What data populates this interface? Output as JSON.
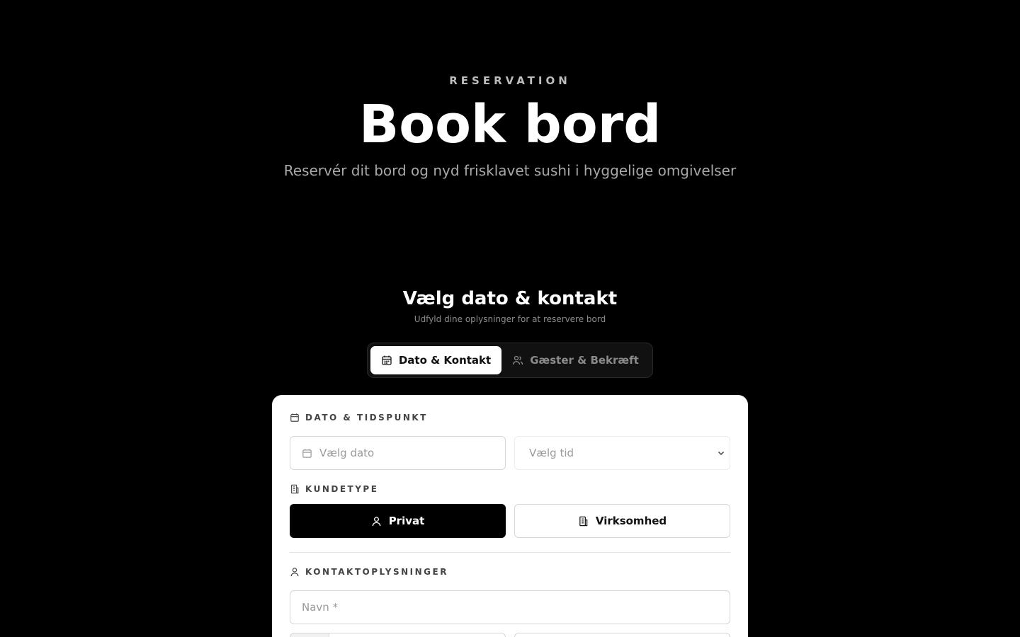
{
  "hero": {
    "eyebrow": "RESERVATION",
    "title": "Book bord",
    "subtitle": "Reservér dit bord og nyd frisklavet sushi i hyggelige omgivelser"
  },
  "section": {
    "title": "Vælg dato & kontakt",
    "subtitle": "Udfyld dine oplysninger for at reservere bord"
  },
  "tabs": [
    {
      "label": "Dato & Kontakt",
      "icon": "calendar-icon",
      "active": true
    },
    {
      "label": "Gæster & Bekræft",
      "icon": "users-icon",
      "active": false
    }
  ],
  "form": {
    "date_time_label": "DATO & TIDSPUNKT",
    "date_placeholder": "Vælg dato",
    "time_placeholder": "Vælg tid",
    "customer_type_label": "KUNDETYPE",
    "customer_types": [
      {
        "label": "Privat",
        "icon": "user-icon",
        "selected": true
      },
      {
        "label": "Virksomhed",
        "icon": "building-icon",
        "selected": false
      }
    ],
    "contact_label": "KONTAKTOPLYSNINGER",
    "name_placeholder": "Navn *"
  },
  "colors": {
    "background": "#000000",
    "card": "#ffffff",
    "accent": "#000000"
  }
}
